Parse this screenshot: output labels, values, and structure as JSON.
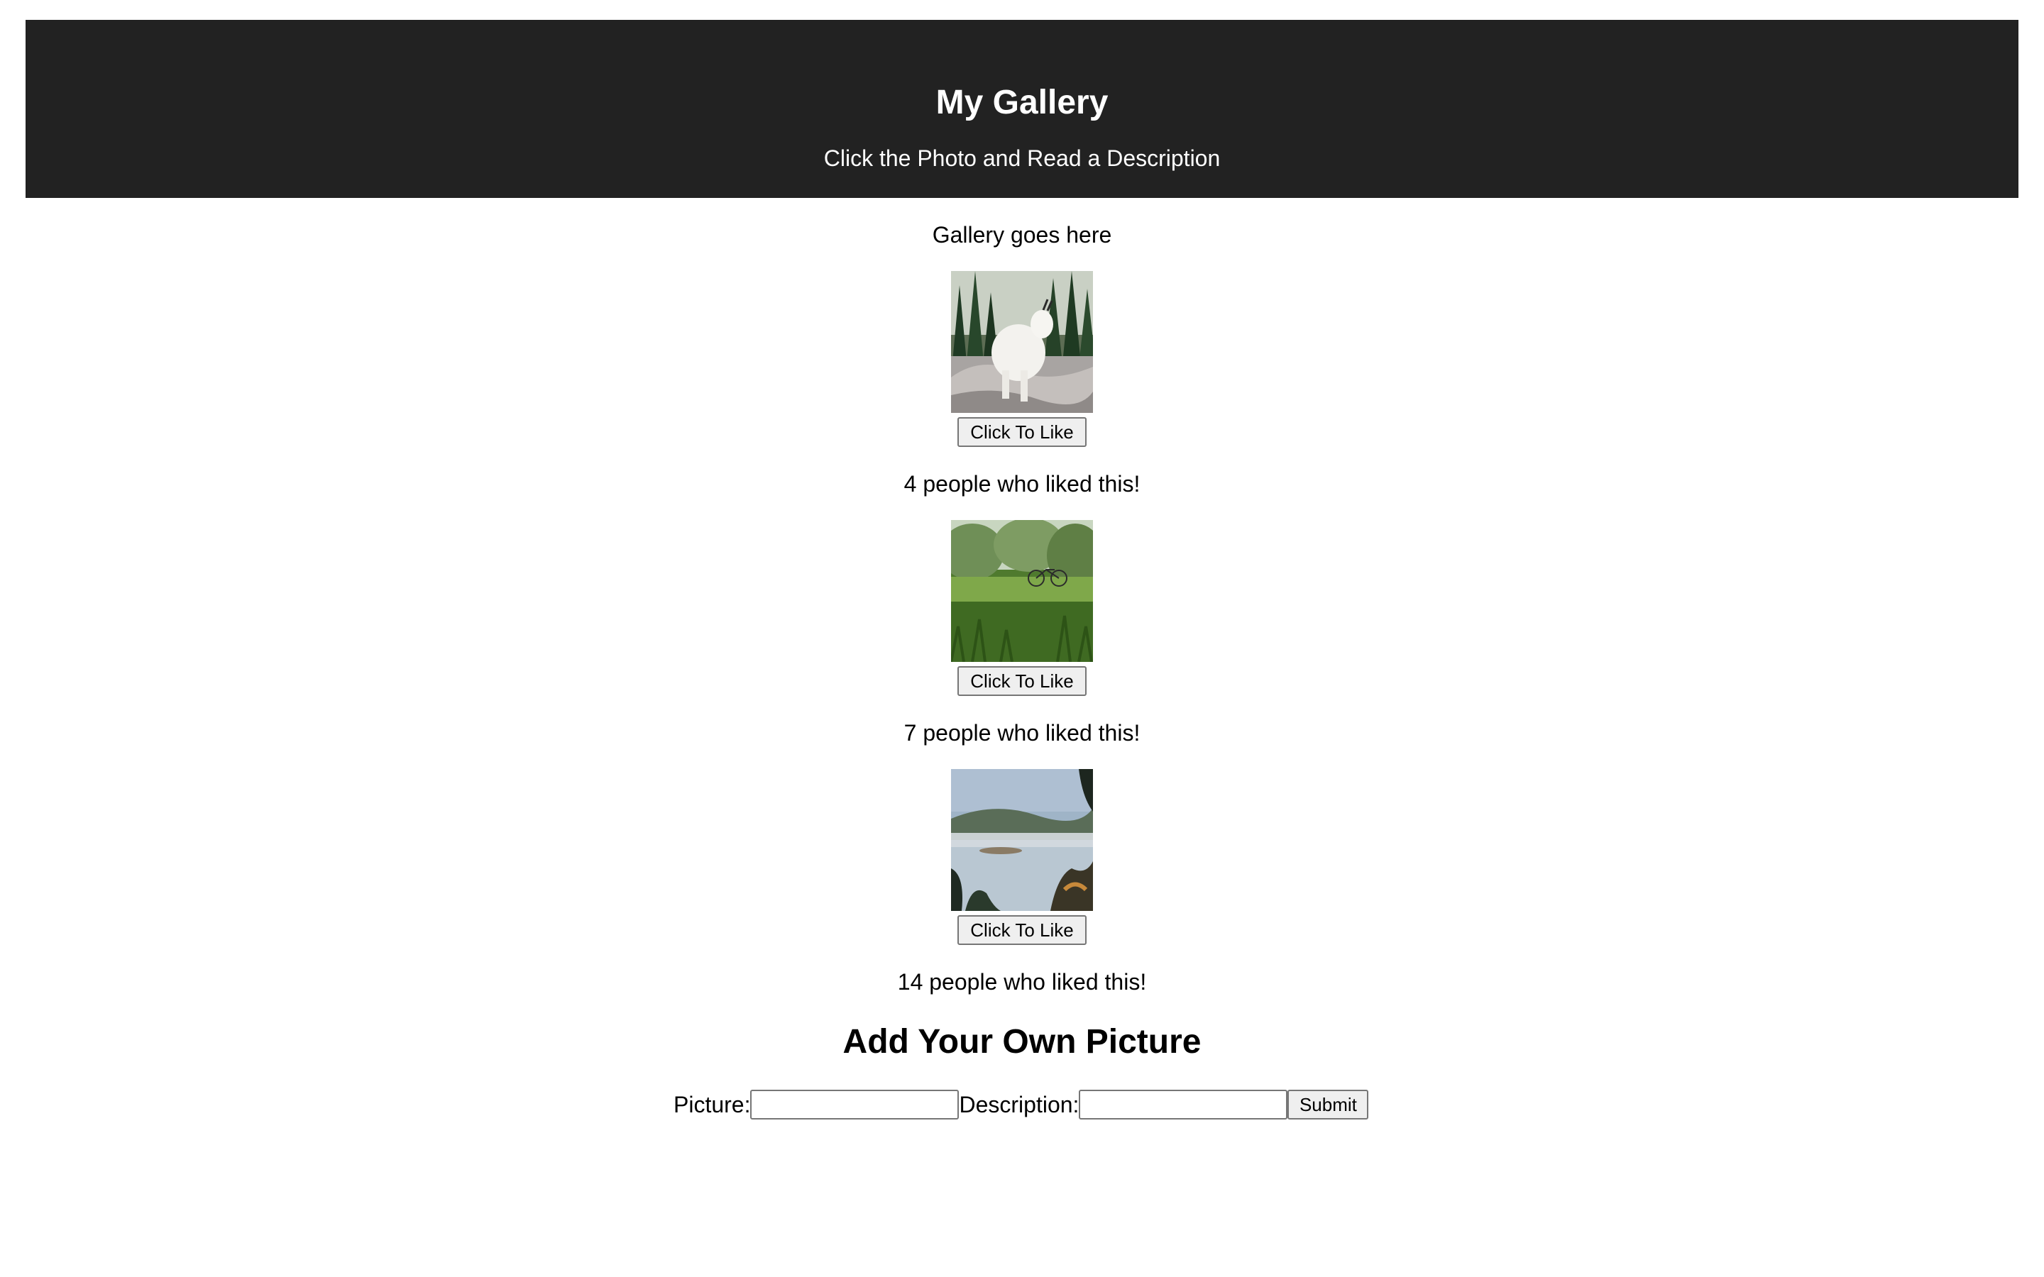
{
  "header": {
    "title": "My Gallery",
    "subtitle": "Click the Photo and Read a Description",
    "background": "#222222"
  },
  "gallery": {
    "placeholder": "Gallery goes here",
    "items": [
      {
        "image": "mountain-goat-photo",
        "like_label": "Click To Like",
        "likes_text": "4 people who liked this!"
      },
      {
        "image": "meadow-bicycle-photo",
        "like_label": "Click To Like",
        "likes_text": "7 people who liked this!"
      },
      {
        "image": "misty-lake-photo",
        "like_label": "Click To Like",
        "likes_text": "14 people who liked this!"
      }
    ]
  },
  "add_form": {
    "title": "Add Your Own Picture",
    "picture_label": "Picture:",
    "picture_value": "",
    "description_label": "Description:",
    "description_value": "",
    "submit_label": "Submit"
  }
}
